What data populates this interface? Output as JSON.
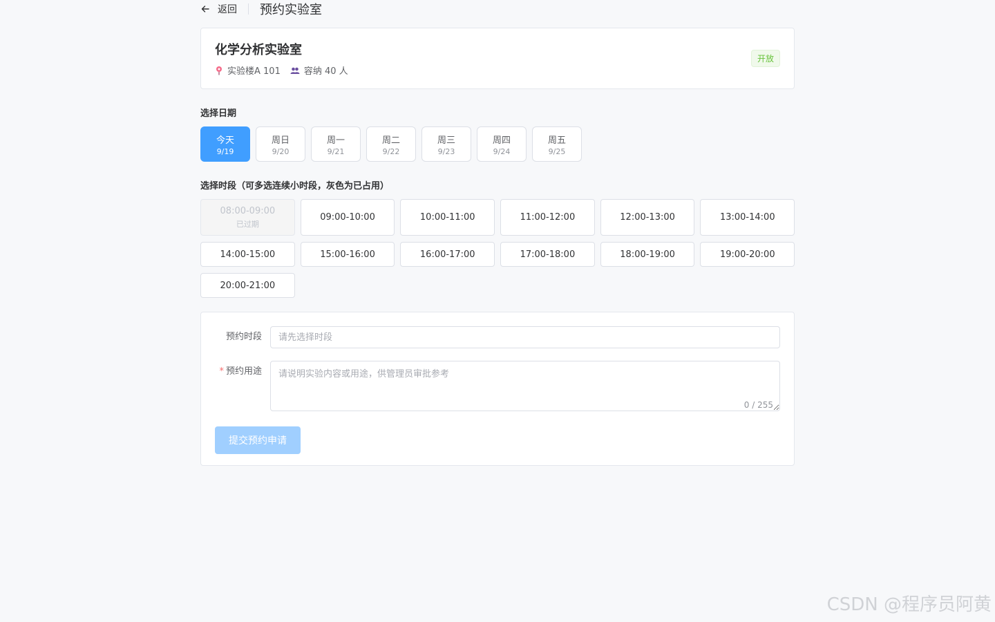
{
  "header": {
    "back_label": "返回",
    "title": "预约实验室"
  },
  "lab": {
    "name": "化学分析实验室",
    "location": "实验楼A 101",
    "capacity": "容纳 40 人",
    "status": "开放",
    "status_color": "#67c23a"
  },
  "date_section": {
    "label": "选择日期",
    "dates": [
      {
        "day": "今天",
        "date": "9/19",
        "selected": true
      },
      {
        "day": "周日",
        "date": "9/20",
        "selected": false
      },
      {
        "day": "周一",
        "date": "9/21",
        "selected": false
      },
      {
        "day": "周二",
        "date": "9/22",
        "selected": false
      },
      {
        "day": "周三",
        "date": "9/23",
        "selected": false
      },
      {
        "day": "周四",
        "date": "9/24",
        "selected": false
      },
      {
        "day": "周五",
        "date": "9/25",
        "selected": false
      }
    ]
  },
  "slot_section": {
    "label": "选择时段（可多选连续小时段，灰色为已占用）",
    "slots": [
      {
        "time": "08:00-09:00",
        "sub": "已过期",
        "disabled": true
      },
      {
        "time": "09:00-10:00"
      },
      {
        "time": "10:00-11:00"
      },
      {
        "time": "11:00-12:00"
      },
      {
        "time": "12:00-13:00"
      },
      {
        "time": "13:00-14:00"
      },
      {
        "time": "14:00-15:00"
      },
      {
        "time": "15:00-16:00"
      },
      {
        "time": "16:00-17:00"
      },
      {
        "time": "17:00-18:00"
      },
      {
        "time": "18:00-19:00"
      },
      {
        "time": "19:00-20:00"
      },
      {
        "time": "20:00-21:00"
      }
    ]
  },
  "form": {
    "slot_label": "预约时段",
    "slot_placeholder": "请先选择时段",
    "slot_value": "",
    "purpose_required_mark": "*",
    "purpose_label": "预约用途",
    "purpose_placeholder": "请说明实验内容或用途，供管理员审批参考",
    "purpose_value": "",
    "char_count": "0 / 255",
    "submit_label": "提交预约申请"
  },
  "colors": {
    "primary": "#409eff",
    "primary_disabled": "#a0cfff",
    "success": "#67c23a"
  },
  "icons": {
    "back": "arrow-left-icon",
    "location": "map-pin-icon",
    "capacity": "users-icon"
  },
  "watermark": "CSDN @程序员阿黄"
}
